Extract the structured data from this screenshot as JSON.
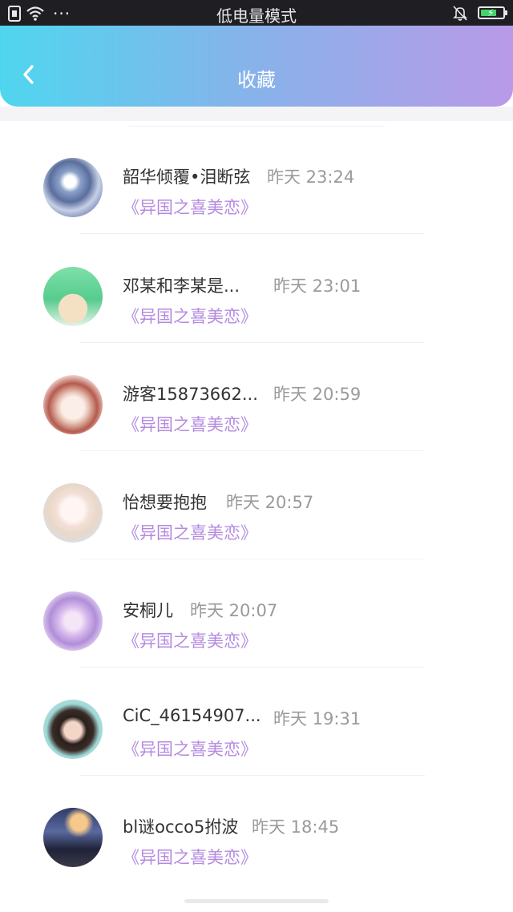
{
  "status_bar": {
    "title": "低电量模式",
    "dots": "···",
    "icons": [
      "sim-icon",
      "wifi-icon",
      "more-dots-icon",
      "mute-bell-icon",
      "battery-charging-icon"
    ],
    "battery_level": 0.62,
    "battery_color": "#44d36a"
  },
  "header": {
    "title": "收藏",
    "back_icon": "chevron-left-icon",
    "gradient": [
      "#4fd6ef",
      "#86b3ea",
      "#b99ae8"
    ]
  },
  "favorites": [
    {
      "name": "韶华倾覆•泪断弦",
      "time": "昨天 23:24",
      "book": "《异国之喜美恋》"
    },
    {
      "name": "邓某和李某是...",
      "time": "昨天 23:01",
      "book": "《异国之喜美恋》"
    },
    {
      "name": "游客15873662...",
      "time": "昨天 20:59",
      "book": "《异国之喜美恋》"
    },
    {
      "name": "怡想要抱抱",
      "time": "昨天 20:57",
      "book": "《异国之喜美恋》"
    },
    {
      "name": "安桐儿",
      "time": "昨天 20:07",
      "book": "《异国之喜美恋》"
    },
    {
      "name": "CiC_46154907...",
      "time": "昨天 19:31",
      "book": "《异国之喜美恋》"
    },
    {
      "name": "bl谜occo5拊波",
      "time": "昨天 18:45",
      "book": "《异国之喜美恋》"
    }
  ],
  "colors": {
    "name": "#333333",
    "time": "#9a9a9a",
    "book_title": "#b48ae0"
  }
}
